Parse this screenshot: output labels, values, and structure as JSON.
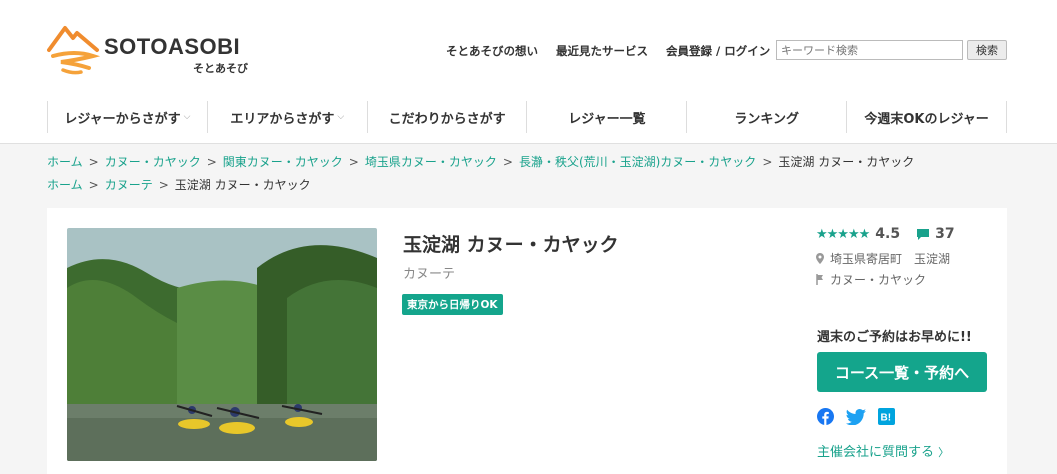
{
  "header": {
    "logo_text": "SOTOASOBI",
    "logo_sub": "そとあそび",
    "links": [
      "そとあそびの想い",
      "最近見たサービス",
      "会員登録 / ログイン"
    ],
    "search_placeholder": "キーワード検索",
    "search_button": "検索"
  },
  "nav": [
    {
      "label": "レジャーからさがす",
      "chevron": "⌵"
    },
    {
      "label": "エリアからさがす",
      "chevron": "⌵"
    },
    {
      "label": "こだわりからさがす",
      "chevron": ""
    },
    {
      "label": "レジャー一覧",
      "chevron": ""
    },
    {
      "label": "ランキング",
      "chevron": ""
    },
    {
      "label": "今週末OKのレジャー",
      "chevron": ""
    }
  ],
  "breadcrumb1": {
    "links": [
      "ホーム",
      "カヌー・カヤック",
      "関東カヌー・カヤック",
      "埼玉県カヌー・カヤック",
      "長瀞・秩父(荒川・玉淀湖)カヌー・カヤック"
    ],
    "current": "玉淀湖 カヌー・カヤック"
  },
  "breadcrumb2": {
    "links": [
      "ホーム",
      "カヌーテ"
    ],
    "current": "玉淀湖 カヌー・カヤック"
  },
  "separator": ">",
  "listing": {
    "title": "玉淀湖 カヌー・カヤック",
    "organizer": "カヌーテ",
    "badge": "東京から日帰りOK",
    "rating": "4.5",
    "stars": "★★★★★",
    "review_count": "37",
    "location": "埼玉県寄居町　玉淀湖",
    "category": "カヌー・カヤック",
    "booking_note": "週末のご予約はお早めに!!",
    "book_button": "コース一覧・予約へ",
    "ask_link": "主催会社に質問する",
    "ask_chevron": "〉"
  },
  "colors": {
    "accent": "#14a58c",
    "link": "#19a28c"
  }
}
